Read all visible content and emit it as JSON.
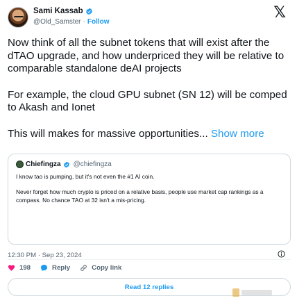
{
  "author": {
    "name": "Sami Kassab",
    "handle": "@Old_Samster",
    "separator": "·",
    "follow_label": "Follow"
  },
  "tweet": {
    "paragraph_1": "Now think of all the subnet tokens that will exist after the dTAO upgrade, and how underpriced they will be relative to comparable standalone deAI projects",
    "paragraph_2": "For example, the cloud GPU subnet (SN 12) will be comped to Akash and Ionet",
    "paragraph_3": "This will makes for massive opportunities...",
    "show_more_label": "Show more"
  },
  "quoted_tweet": {
    "name": "Chiefingza",
    "handle": "@chiefingza",
    "paragraph_1": "I know tao is pumping, but it's not even the #1 AI coin.",
    "paragraph_2": "Never forget how much crypto is priced on a relative basis, people use market cap rankings as a compass. No chance TAO at 32 isn't a mis-pricing."
  },
  "timestamp": "12:30 PM · Sep 23, 2024",
  "actions": {
    "like_count": "198",
    "reply_label": "Reply",
    "copy_link_label": "Copy link"
  },
  "read_replies_label": "Read 12 replies",
  "colors": {
    "accent": "#1d9bf0",
    "like": "#f91880",
    "text": "#0f1419",
    "muted": "#536471"
  },
  "icons": [
    "verified-badge-icon",
    "x-logo-icon",
    "info-icon",
    "heart-icon",
    "reply-icon",
    "link-icon"
  ]
}
